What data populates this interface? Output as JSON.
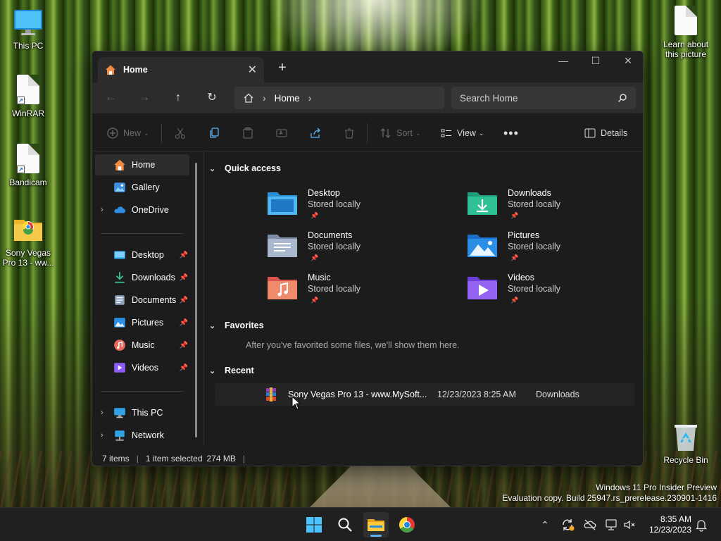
{
  "desktop": {
    "icons": [
      {
        "label": "This PC"
      },
      {
        "label": "WinRAR"
      },
      {
        "label": "Bandicam"
      },
      {
        "label": "Sony Vegas Pro 13 - ww..."
      },
      {
        "label": "Learn about this picture"
      },
      {
        "label": "Recycle Bin"
      }
    ],
    "watermark_line1": "Windows 11 Pro Insider Preview",
    "watermark_line2": "Evaluation copy. Build 25947.rs_prerelease.230901-1416"
  },
  "window": {
    "tab_title": "Home",
    "address_crumb": "Home",
    "search_placeholder": "Search Home",
    "toolbar": {
      "new_label": "New",
      "sort_label": "Sort",
      "view_label": "View",
      "details_label": "Details"
    },
    "sidebar": {
      "top": [
        {
          "label": "Home"
        },
        {
          "label": "Gallery"
        },
        {
          "label": "OneDrive"
        }
      ],
      "pinned": [
        {
          "label": "Desktop"
        },
        {
          "label": "Downloads"
        },
        {
          "label": "Documents"
        },
        {
          "label": "Pictures"
        },
        {
          "label": "Music"
        },
        {
          "label": "Videos"
        }
      ],
      "bottom": [
        {
          "label": "This PC"
        },
        {
          "label": "Network"
        }
      ]
    },
    "quick_access": {
      "heading": "Quick access",
      "items": [
        {
          "name": "Desktop",
          "status": "Stored locally"
        },
        {
          "name": "Downloads",
          "status": "Stored locally"
        },
        {
          "name": "Documents",
          "status": "Stored locally"
        },
        {
          "name": "Pictures",
          "status": "Stored locally"
        },
        {
          "name": "Music",
          "status": "Stored locally"
        },
        {
          "name": "Videos",
          "status": "Stored locally"
        }
      ]
    },
    "favorites": {
      "heading": "Favorites",
      "empty_message": "After you've favorited some files, we'll show them here."
    },
    "recent": {
      "heading": "Recent",
      "items": [
        {
          "name": "Sony Vegas Pro 13 - www.MySoft...",
          "date": "12/23/2023 8:25 AM",
          "location": "Downloads"
        }
      ]
    },
    "status": {
      "items_count": "7 items",
      "selection": "1 item selected",
      "size": "274 MB"
    }
  },
  "taskbar": {
    "time": "8:35 AM",
    "date": "12/23/2023"
  },
  "colors": {
    "window_bg": "#1c1c1c",
    "accent": "#5fb2f2",
    "taskbar_bg": "#202020"
  }
}
